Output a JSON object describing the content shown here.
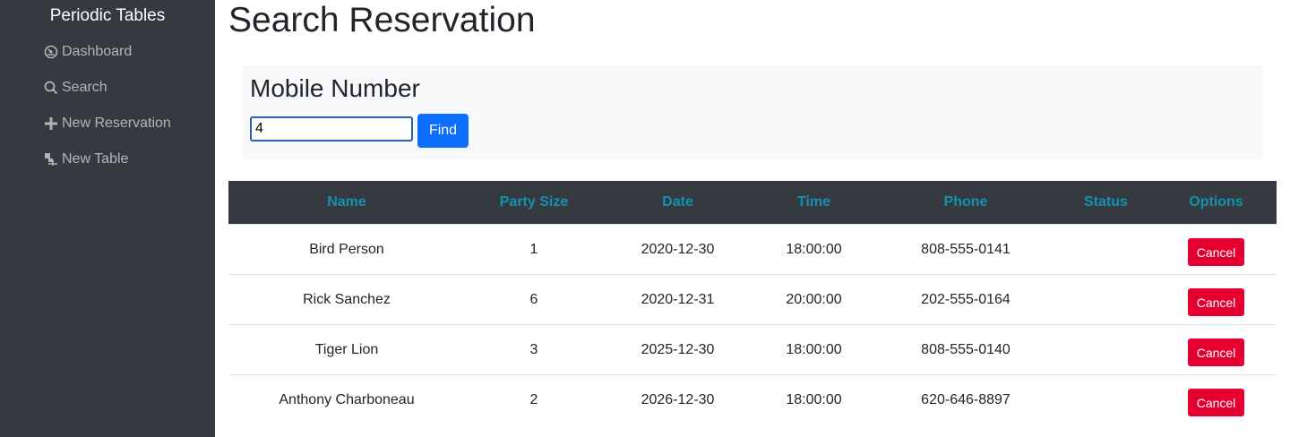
{
  "sidebar": {
    "brand": "Periodic Tables",
    "items": [
      {
        "label": "Dashboard",
        "icon": "dashboard-icon"
      },
      {
        "label": "Search",
        "icon": "search-icon"
      },
      {
        "label": "New Reservation",
        "icon": "plus-icon"
      },
      {
        "label": "New Table",
        "icon": "table-icon"
      }
    ]
  },
  "page": {
    "title": "Search Reservation"
  },
  "search": {
    "heading": "Mobile Number",
    "input_value": "4",
    "find_label": "Find"
  },
  "table": {
    "headers": [
      "Name",
      "Party Size",
      "Date",
      "Time",
      "Phone",
      "Status",
      "Options"
    ],
    "rows": [
      {
        "name": "Bird Person",
        "party_size": "1",
        "date": "2020-12-30",
        "time": "18:00:00",
        "phone": "808-555-0141",
        "status": "",
        "action": "Cancel"
      },
      {
        "name": "Rick Sanchez",
        "party_size": "6",
        "date": "2020-12-31",
        "time": "20:00:00",
        "phone": "202-555-0164",
        "status": "",
        "action": "Cancel"
      },
      {
        "name": "Tiger Lion",
        "party_size": "3",
        "date": "2025-12-30",
        "time": "18:00:00",
        "phone": "808-555-0140",
        "status": "",
        "action": "Cancel"
      },
      {
        "name": "Anthony Charboneau",
        "party_size": "2",
        "date": "2026-12-30",
        "time": "18:00:00",
        "phone": "620-646-8897",
        "status": "",
        "action": "Cancel"
      }
    ]
  },
  "colors": {
    "sidebar_bg": "#343a40",
    "header_text": "#1591b0",
    "primary": "#0d6efd",
    "danger": "#e60031"
  }
}
